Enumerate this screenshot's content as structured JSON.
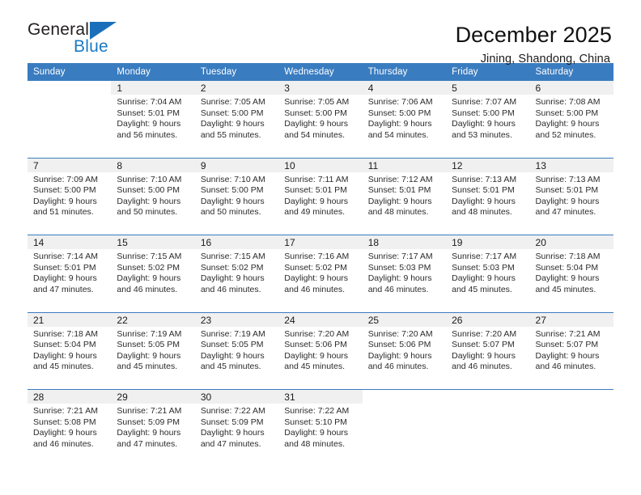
{
  "brand": {
    "name_top": "General",
    "name_bottom": "Blue",
    "triangle_icon": "blue-triangle-icon",
    "color_dark": "#231f20",
    "color_blue": "#1b7ac4"
  },
  "header": {
    "title": "December 2025",
    "subtitle": "Jining, Shandong, China"
  },
  "theme": {
    "header_blue": "#3a7cc0",
    "band_gray": "#f0f0f0",
    "text": "#2b2b2b"
  },
  "calendar": {
    "weekday_headers": [
      "Sunday",
      "Monday",
      "Tuesday",
      "Wednesday",
      "Thursday",
      "Friday",
      "Saturday"
    ],
    "weeks": [
      [
        {
          "day": "",
          "lines": []
        },
        {
          "day": "1",
          "lines": [
            "Sunrise: 7:04 AM",
            "Sunset: 5:01 PM",
            "Daylight: 9 hours",
            "and 56 minutes."
          ]
        },
        {
          "day": "2",
          "lines": [
            "Sunrise: 7:05 AM",
            "Sunset: 5:00 PM",
            "Daylight: 9 hours",
            "and 55 minutes."
          ]
        },
        {
          "day": "3",
          "lines": [
            "Sunrise: 7:05 AM",
            "Sunset: 5:00 PM",
            "Daylight: 9 hours",
            "and 54 minutes."
          ]
        },
        {
          "day": "4",
          "lines": [
            "Sunrise: 7:06 AM",
            "Sunset: 5:00 PM",
            "Daylight: 9 hours",
            "and 54 minutes."
          ]
        },
        {
          "day": "5",
          "lines": [
            "Sunrise: 7:07 AM",
            "Sunset: 5:00 PM",
            "Daylight: 9 hours",
            "and 53 minutes."
          ]
        },
        {
          "day": "6",
          "lines": [
            "Sunrise: 7:08 AM",
            "Sunset: 5:00 PM",
            "Daylight: 9 hours",
            "and 52 minutes."
          ]
        }
      ],
      [
        {
          "day": "7",
          "lines": [
            "Sunrise: 7:09 AM",
            "Sunset: 5:00 PM",
            "Daylight: 9 hours",
            "and 51 minutes."
          ]
        },
        {
          "day": "8",
          "lines": [
            "Sunrise: 7:10 AM",
            "Sunset: 5:00 PM",
            "Daylight: 9 hours",
            "and 50 minutes."
          ]
        },
        {
          "day": "9",
          "lines": [
            "Sunrise: 7:10 AM",
            "Sunset: 5:00 PM",
            "Daylight: 9 hours",
            "and 50 minutes."
          ]
        },
        {
          "day": "10",
          "lines": [
            "Sunrise: 7:11 AM",
            "Sunset: 5:01 PM",
            "Daylight: 9 hours",
            "and 49 minutes."
          ]
        },
        {
          "day": "11",
          "lines": [
            "Sunrise: 7:12 AM",
            "Sunset: 5:01 PM",
            "Daylight: 9 hours",
            "and 48 minutes."
          ]
        },
        {
          "day": "12",
          "lines": [
            "Sunrise: 7:13 AM",
            "Sunset: 5:01 PM",
            "Daylight: 9 hours",
            "and 48 minutes."
          ]
        },
        {
          "day": "13",
          "lines": [
            "Sunrise: 7:13 AM",
            "Sunset: 5:01 PM",
            "Daylight: 9 hours",
            "and 47 minutes."
          ]
        }
      ],
      [
        {
          "day": "14",
          "lines": [
            "Sunrise: 7:14 AM",
            "Sunset: 5:01 PM",
            "Daylight: 9 hours",
            "and 47 minutes."
          ]
        },
        {
          "day": "15",
          "lines": [
            "Sunrise: 7:15 AM",
            "Sunset: 5:02 PM",
            "Daylight: 9 hours",
            "and 46 minutes."
          ]
        },
        {
          "day": "16",
          "lines": [
            "Sunrise: 7:15 AM",
            "Sunset: 5:02 PM",
            "Daylight: 9 hours",
            "and 46 minutes."
          ]
        },
        {
          "day": "17",
          "lines": [
            "Sunrise: 7:16 AM",
            "Sunset: 5:02 PM",
            "Daylight: 9 hours",
            "and 46 minutes."
          ]
        },
        {
          "day": "18",
          "lines": [
            "Sunrise: 7:17 AM",
            "Sunset: 5:03 PM",
            "Daylight: 9 hours",
            "and 46 minutes."
          ]
        },
        {
          "day": "19",
          "lines": [
            "Sunrise: 7:17 AM",
            "Sunset: 5:03 PM",
            "Daylight: 9 hours",
            "and 45 minutes."
          ]
        },
        {
          "day": "20",
          "lines": [
            "Sunrise: 7:18 AM",
            "Sunset: 5:04 PM",
            "Daylight: 9 hours",
            "and 45 minutes."
          ]
        }
      ],
      [
        {
          "day": "21",
          "lines": [
            "Sunrise: 7:18 AM",
            "Sunset: 5:04 PM",
            "Daylight: 9 hours",
            "and 45 minutes."
          ]
        },
        {
          "day": "22",
          "lines": [
            "Sunrise: 7:19 AM",
            "Sunset: 5:05 PM",
            "Daylight: 9 hours",
            "and 45 minutes."
          ]
        },
        {
          "day": "23",
          "lines": [
            "Sunrise: 7:19 AM",
            "Sunset: 5:05 PM",
            "Daylight: 9 hours",
            "and 45 minutes."
          ]
        },
        {
          "day": "24",
          "lines": [
            "Sunrise: 7:20 AM",
            "Sunset: 5:06 PM",
            "Daylight: 9 hours",
            "and 45 minutes."
          ]
        },
        {
          "day": "25",
          "lines": [
            "Sunrise: 7:20 AM",
            "Sunset: 5:06 PM",
            "Daylight: 9 hours",
            "and 46 minutes."
          ]
        },
        {
          "day": "26",
          "lines": [
            "Sunrise: 7:20 AM",
            "Sunset: 5:07 PM",
            "Daylight: 9 hours",
            "and 46 minutes."
          ]
        },
        {
          "day": "27",
          "lines": [
            "Sunrise: 7:21 AM",
            "Sunset: 5:07 PM",
            "Daylight: 9 hours",
            "and 46 minutes."
          ]
        }
      ],
      [
        {
          "day": "28",
          "lines": [
            "Sunrise: 7:21 AM",
            "Sunset: 5:08 PM",
            "Daylight: 9 hours",
            "and 46 minutes."
          ]
        },
        {
          "day": "29",
          "lines": [
            "Sunrise: 7:21 AM",
            "Sunset: 5:09 PM",
            "Daylight: 9 hours",
            "and 47 minutes."
          ]
        },
        {
          "day": "30",
          "lines": [
            "Sunrise: 7:22 AM",
            "Sunset: 5:09 PM",
            "Daylight: 9 hours",
            "and 47 minutes."
          ]
        },
        {
          "day": "31",
          "lines": [
            "Sunrise: 7:22 AM",
            "Sunset: 5:10 PM",
            "Daylight: 9 hours",
            "and 48 minutes."
          ]
        },
        {
          "day": "",
          "lines": []
        },
        {
          "day": "",
          "lines": []
        },
        {
          "day": "",
          "lines": []
        }
      ]
    ]
  }
}
